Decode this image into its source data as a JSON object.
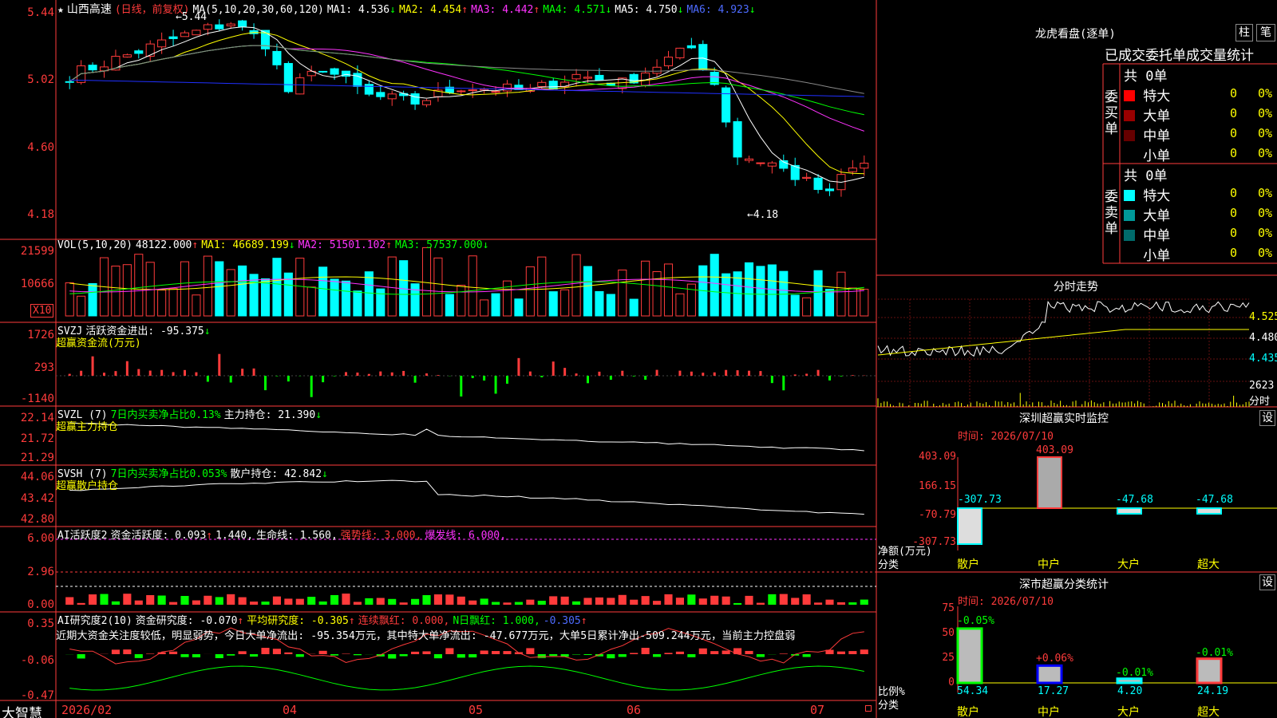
{
  "colors": {
    "up": "#ff3b3b",
    "down": "#00ffff",
    "grid": "#ff3b3b",
    "ma1": "#ffffff",
    "ma2": "#ffff00",
    "ma3": "#ff33ff",
    "ma4": "#00ff00",
    "ma5": "#888888",
    "ma6": "#2030ff"
  },
  "kline": {
    "star": "★",
    "stock_name": "山西高速",
    "mode": "(日线，前复权)",
    "ma_params": "MA(5,10,20,30,60,120)",
    "ma1": "MA1: 4.536",
    "ma1_arrow": "↓",
    "ma2": "MA2: 4.454",
    "ma2_arrow": "↑",
    "ma3": "MA3: 4.442",
    "ma3_arrow": "↑",
    "ma4": "MA4: 4.571",
    "ma4_arrow": "↓",
    "ma5": "MA5: 4.750",
    "ma5_arrow": "↓",
    "ma6": "MA6: 4.923",
    "ma6_arrow": "↓",
    "high_label": "←5.44",
    "low_label": "←4.18",
    "axis": [
      "5.44",
      "5.02",
      "4.60",
      "4.18"
    ]
  },
  "vol": {
    "params": "VOL(5,10,20)",
    "value": "48122.000",
    "value_arrow": "↑",
    "ma1": "MA1: 46689.199",
    "ma1_arrow": "↓",
    "ma2": "MA2: 51501.102",
    "ma2_arrow": "↑",
    "ma3": "MA3: 57537.000",
    "ma3_arrow": "↓",
    "axis": [
      "21599",
      "10666"
    ],
    "unit": "X10"
  },
  "svzj": {
    "name": "SVZJ",
    "label": "活跃资金进出: -95.375",
    "arrow": "↓",
    "sub": "超赢资金流(万元)",
    "axis": [
      "1726",
      "293",
      "-1140"
    ]
  },
  "svzl": {
    "name": "SVZL (7)",
    "text": "7日内买卖净占比0.13%",
    "label": "主力持仓: 21.390",
    "arrow": "↓",
    "sub": "超赢主力持仓",
    "axis": [
      "22.14",
      "21.72",
      "21.29"
    ]
  },
  "svsh": {
    "name": "SVSH (7)",
    "text": "7日内买卖净占比0.053%",
    "label": "散户持仓: 42.842",
    "arrow": "↓",
    "sub": "超赢散户持仓",
    "axis": [
      "44.06",
      "43.42",
      "42.80"
    ]
  },
  "ai1": {
    "name": "AI活跃度2",
    "label": "资金活跃度: 0.093",
    "arrow": "↑",
    "v2": "1.440,",
    "v3": "生命线: 1.560,",
    "v4": "强势线: 3.000,",
    "v5": "爆发线: 6.000,",
    "axis": [
      "6.00",
      "2.96",
      "0.00"
    ]
  },
  "ai2": {
    "name": "AI研究度2(10)",
    "label": "资金研究度: -0.070",
    "arrow": "↑",
    "avg": "平均研究度: -0.305",
    "avg_arrow": "↑",
    "lian": "连续飘红: 0.000,",
    "n": "N日飘红: 1.000,",
    "last": "-0.305",
    "last_arrow": "↑",
    "desc": "近期大资金关注度较低，明显弱势，今日大单净流出: -95.354万元，其中特大单净流出: -47.677万元，大单5日累计净出-509.244万元，当前主力控盘弱",
    "axis": [
      "0.35",
      "-0.06",
      "-0.47"
    ]
  },
  "xaxis": {
    "brand": "大智慧",
    "labels": [
      "2026/02",
      "04",
      "05",
      "06",
      "07"
    ]
  },
  "longhu": {
    "title": "龙虎看盘(逐单)",
    "btn1": "柱",
    "btn2": "笔",
    "head": "已成交委托单成交量统计",
    "buy": {
      "side": "委买单",
      "total": "共 0单",
      "rows": [
        {
          "name": "特大",
          "v": "0",
          "p": "0%"
        },
        {
          "name": "大单",
          "v": "0",
          "p": "0%"
        },
        {
          "name": "中单",
          "v": "0",
          "p": "0%"
        },
        {
          "name": "小单",
          "v": "0",
          "p": "0%"
        }
      ]
    },
    "sell": {
      "side": "委卖单",
      "total": "共 0单",
      "rows": [
        {
          "name": "特大",
          "v": "0",
          "p": "0%"
        },
        {
          "name": "大单",
          "v": "0",
          "p": "0%"
        },
        {
          "name": "中单",
          "v": "0",
          "p": "0%"
        },
        {
          "name": "小单",
          "v": "0",
          "p": "0%"
        }
      ]
    }
  },
  "intraday": {
    "title": "分时走势",
    "axis": [
      "4.525",
      "4.480",
      "4.435"
    ],
    "vol": "2623",
    "vol_unit": "分时"
  },
  "monitor": {
    "title": "深圳超赢实时监控",
    "btn": "设",
    "time": "时间: 2026/07/10",
    "axis": [
      "403.09",
      "166.15",
      "-70.79",
      "-307.73"
    ],
    "ylabel": "净额(万元)",
    "xlabel": "分类",
    "cats": [
      "散户",
      "中户",
      "大户",
      "超大"
    ],
    "labels": [
      "-307.73",
      "403.09",
      "-47.68",
      "-47.68"
    ]
  },
  "classify": {
    "title": "深市超赢分类统计",
    "btn": "设",
    "time": "时间: 2026/07/10",
    "axis": [
      "75",
      "50",
      "25",
      "0"
    ],
    "ylabel": "比例%",
    "xlabel": "分类",
    "cats": [
      "散户",
      "中户",
      "大户",
      "超大"
    ],
    "top": [
      "-0.05%",
      "+0.06%",
      "-0.01%",
      "-0.01%"
    ],
    "bottom": [
      "54.34",
      "17.27",
      "4.20",
      "24.19"
    ]
  },
  "chart_data": [
    {
      "type": "bar",
      "title": "深圳超赢实时监控",
      "categories": [
        "散户",
        "中户",
        "大户",
        "超大"
      ],
      "values": [
        -307.73,
        403.09,
        -47.68,
        -47.68
      ],
      "ylabel": "净额(万元)",
      "xlabel": "分类",
      "ylim": [
        -307.73,
        403.09
      ]
    },
    {
      "type": "bar",
      "title": "深市超赢分类统计",
      "categories": [
        "散户",
        "中户",
        "大户",
        "超大"
      ],
      "values": [
        54.34,
        17.27,
        4.2,
        24.19
      ],
      "ylabel": "比例%",
      "xlabel": "分类",
      "ylim": [
        0,
        75
      ]
    }
  ]
}
